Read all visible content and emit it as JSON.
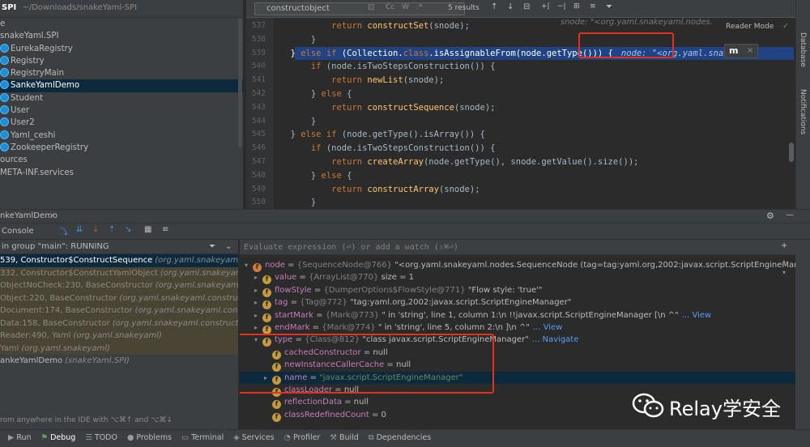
{
  "project": {
    "title": "SPI",
    "path": "~/Downloads/snakeYaml-SPI",
    "tree": [
      {
        "label": "e",
        "icon": "none",
        "indent": 0
      },
      {
        "label": "snakeYaml.SPI",
        "icon": "none",
        "indent": 0
      },
      {
        "label": "EurekaRegistry",
        "icon": "class-icon",
        "indent": 0
      },
      {
        "label": "Registry",
        "icon": "class-icon",
        "indent": 0
      },
      {
        "label": "RegistryMain",
        "icon": "class-icon",
        "indent": 0
      },
      {
        "label": "SankeYamlDemo",
        "icon": "class-icon",
        "indent": 0,
        "selected": true
      },
      {
        "label": "Student",
        "icon": "class-icon",
        "indent": 0
      },
      {
        "label": "User",
        "icon": "class-icon",
        "indent": 0
      },
      {
        "label": "User2",
        "icon": "class-icon",
        "indent": 0
      },
      {
        "label": "Yaml_ceshi",
        "icon": "class-icon",
        "indent": 0
      },
      {
        "label": "ZookeeperRegistry",
        "icon": "class-icon",
        "indent": 0
      },
      {
        "label": "ources",
        "icon": "none",
        "indent": 0
      },
      {
        "label": "META-INF.services",
        "icon": "none",
        "indent": 0
      }
    ]
  },
  "find": {
    "query": "constructobject",
    "results": "5 results",
    "reader_mode": "Reader Mode"
  },
  "editor": {
    "lines": [
      {
        "n": "537",
        "code": "                return constructSet(snode);"
      },
      {
        "n": "538",
        "code": "            }"
      },
      {
        "n": "539",
        "code": "        } else if (Collection.class.isAssignableFrom(node.getType())) {",
        "hint": "node: \"<org.yaml.snake"
      },
      {
        "n": "540",
        "code": "            if (node.isTwoStepsConstruction()) {"
      },
      {
        "n": "541",
        "code": "                return newList(snode);"
      },
      {
        "n": "542",
        "code": "            } else {"
      },
      {
        "n": "543",
        "code": "                return constructSequence(snode);"
      },
      {
        "n": "544",
        "code": "            }"
      },
      {
        "n": "545",
        "code": "        } else if (node.getType().isArray()) {"
      },
      {
        "n": "546",
        "code": "            if (node.isTwoStepsConstruction()) {"
      },
      {
        "n": "547",
        "code": "                return createArray(node.getType(), snode.getValue().size());"
      },
      {
        "n": "548",
        "code": "            } else {"
      },
      {
        "n": "549",
        "code": "                return constructArray(snode);"
      },
      {
        "n": "550",
        "code": "            }"
      }
    ],
    "line537_hint": "snode: \"<org.yaml.snakeyaml.nodes."
  },
  "right_strip": {
    "database": "Database",
    "notifications": "Notifications"
  },
  "debug": {
    "session": "nkeYamlDemo",
    "console_tab": "Console",
    "thread": "in group \"main\": RUNNING",
    "eval_placeholder": "Evaluate expression (⏎) or add a watch (⇧⌘⏎)",
    "frames": [
      {
        "text": "539, Constructor$ConstructSequence",
        "pkg": "(org.yaml.snakeyaml.co",
        "kind": "sel"
      },
      {
        "text": "332, Constructor$ConstructYamlObject",
        "pkg": "(org.yaml.snakeyaml.co",
        "kind": "lib"
      },
      {
        "text": "ObjectNoCheck:230, BaseConstructor",
        "pkg": "(org.yaml.snakeyaml.constr",
        "kind": "lib"
      },
      {
        "text": "Object:220, BaseConstructor",
        "pkg": "(org.yaml.snakeyaml.constructor)",
        "kind": "lib"
      },
      {
        "text": "Document:174, BaseConstructor",
        "pkg": "(org.yaml.snakeyaml.construct",
        "kind": "lib"
      },
      {
        "text": "Data:158, BaseConstructor",
        "pkg": "(org.yaml.snakeyaml.constructor)",
        "kind": "lib"
      },
      {
        "text": "Reader:490, Yaml",
        "pkg": "(org.yaml.snakeyaml)",
        "kind": "lib"
      },
      {
        "text": "Yaml",
        "pkg": "(org.yaml.snakeyaml)",
        "kind": "lib"
      },
      {
        "text": "ankeYamlDemo",
        "pkg": "(snakeYaml.SPI)",
        "kind": "normal"
      }
    ],
    "frames_hint": "rom anywhere in the IDE with ⌥⌘↑ and ⌥⌘↓",
    "vars": [
      {
        "tri": "▾",
        "name": "node",
        "type": "{SequenceNode@766}",
        "val": "\"<org.yaml.snakeyaml.nodes.SequenceNode (tag=tag:yaml.org,2002:javax.script.ScriptEngineMana",
        "link": "... View",
        "indent": 0
      },
      {
        "tri": "▸",
        "name": "value",
        "type": "{ArrayList@770}",
        "val": "size = 1",
        "indent": 1
      },
      {
        "tri": "▸",
        "name": "flowStyle",
        "type": "{DumperOptions$FlowStyle@771}",
        "val": "\"Flow style: 'true'\"",
        "indent": 1
      },
      {
        "tri": "▸",
        "name": "tag",
        "type": "{Tag@772}",
        "val": "\"tag:yaml.org,2002:javax.script.ScriptEngineManager\"",
        "indent": 1
      },
      {
        "tri": "▸",
        "name": "startMark",
        "type": "{Mark@773}",
        "val": "\" in 'string', line 1, column 1:\\n    !!javax.script.ScriptEngineManager [\\n    ^\"",
        "link": "... View",
        "indent": 1
      },
      {
        "tri": "▸",
        "name": "endMark",
        "type": "{Mark@774}",
        "val": "\" in 'string', line 5, column 2:\\n    ]\\n    ^\"",
        "link": "... View",
        "indent": 1
      },
      {
        "tri": "▾",
        "name": "type",
        "type": "{Class@812}",
        "val": "\"class javax.script.ScriptEngineManager\"",
        "link": "... Navigate",
        "indent": 1
      },
      {
        "tri": "",
        "name": "cachedConstructor",
        "type": "",
        "val": "= null",
        "indent": 2
      },
      {
        "tri": "",
        "name": "newInstanceCallerCache",
        "type": "",
        "val": "= null",
        "indent": 2
      },
      {
        "tri": "▸",
        "name": "name",
        "type": "",
        "val": "\"javax.script.ScriptEngineManager\"",
        "indent": 2,
        "selected": true,
        "str": true
      },
      {
        "tri": "",
        "name": "classLoader",
        "type": "",
        "val": "= null",
        "indent": 2
      },
      {
        "tri": "",
        "name": "reflectionData",
        "type": "",
        "val": "= null",
        "indent": 2
      },
      {
        "tri": "",
        "name": "classRedefinedCount",
        "type": "",
        "val": "= 0",
        "indent": 2
      }
    ]
  },
  "bottom_tools": [
    "Run",
    "Debug",
    "TODO",
    "Problems",
    "Terminal",
    "Services",
    "Profiler",
    "Build",
    "Dependencies"
  ],
  "watermark": "Relay学安全",
  "colors": {
    "accent": "#214283",
    "highlight_box": "#e0321f",
    "selection": "#0d293e"
  }
}
